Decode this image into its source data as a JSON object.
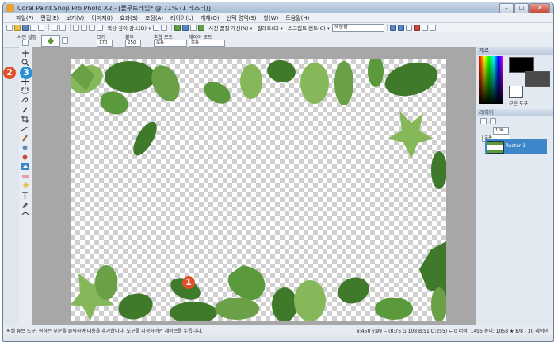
{
  "window": {
    "title": "Corel Paint Shop Pro Photo X2 - [풀무트레임* @ 71% (1 레스터)]",
    "min_glyph": "–",
    "max_glyph": "□",
    "close_glyph": "✕"
  },
  "menu": [
    "파일(F)",
    "편집(E)",
    "보기(V)",
    "이미지(I)",
    "효과(S)",
    "조정(A)",
    "레이어(L)",
    "개체(O)",
    "선택 영역(S)",
    "창(W)",
    "도움말(H)"
  ],
  "toolbar": {
    "auto_fix_label": "색상 깊이 감소(D) ▾",
    "photo_fix_label": "사진 품질 개선(N) ▾",
    "palette_label": "팔레트(E) ▾",
    "script_label": "스크립트 컨트(C) ▾",
    "script_combo": "색분할"
  },
  "tool_options": {
    "preset_label": "사전 설정",
    "size_label": "크기",
    "size_value": "170",
    "opacity_label": "불투",
    "opacity_value": "250",
    "blend_label": "혼합 모드",
    "blend_value": "보통",
    "mode_label": "레이어 모드",
    "mode_value": "보통"
  },
  "materials_panel": {
    "title": "재료",
    "all_tools_label": "모든 도구"
  },
  "layers_panel": {
    "title": "레이어",
    "opacity_value": "100",
    "blend_value": "보통",
    "layer_name": "Raster 1"
  },
  "status": {
    "hint": "픽셀 튜브 도구: 원하는 부분을 클릭하여 내용을 추가합니다. 도구를 지정하려면 세이브를 누릅니다.",
    "info": "x:450 y:99 -- (R:75 G:108 B:51 O:255) ← 0 너비: 1495 높이: 1058 ★ 8/8 - 30 레이어"
  },
  "callouts": [
    "1",
    "2",
    "3"
  ],
  "colors": {
    "leaf_dark": "#3f7a2a",
    "leaf_mid": "#5b9a3c",
    "leaf_light": "#86b85a",
    "callout_red": "#e0522b",
    "callout_blue": "#2b8fd6",
    "layer_selected": "#3d86c9"
  }
}
